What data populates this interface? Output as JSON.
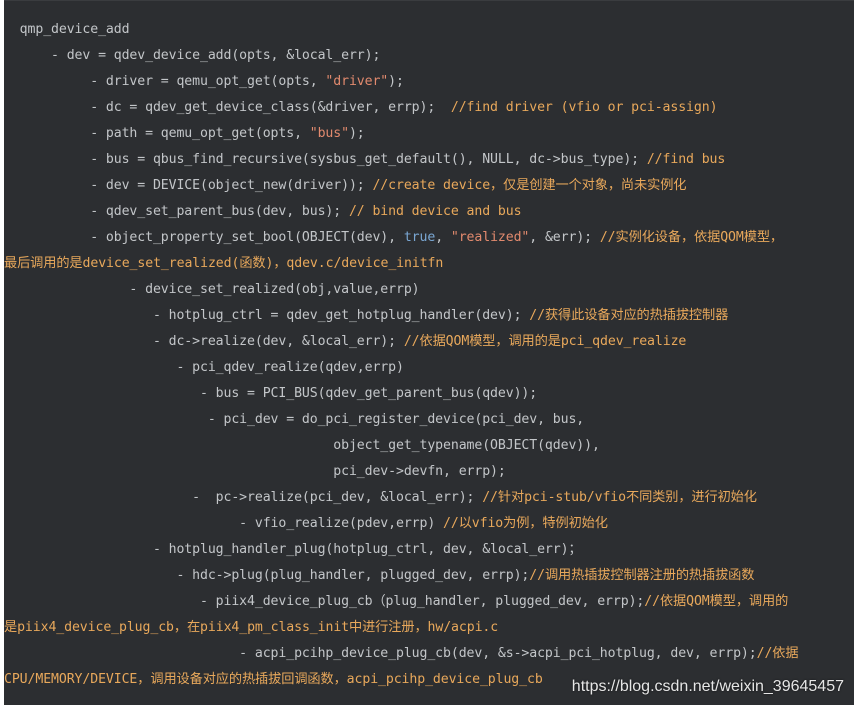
{
  "colors": {
    "background": "#2c2e31",
    "code": "#c3c6c9",
    "string": "#e28a6e",
    "keyword": "#7aa7d3",
    "comment": "#e8a85b"
  },
  "lines": [
    [
      {
        "t": "  qmp_device_add"
      }
    ],
    [
      {
        "t": "      - dev = qdev_device_add(opts, &local_err);"
      }
    ],
    [
      {
        "t": "           - driver = qemu_opt_get(opts, "
      },
      {
        "t": "\"driver\"",
        "c": "str"
      },
      {
        "t": ");"
      }
    ],
    [
      {
        "t": "           - dc = qdev_get_device_class(&driver, errp);  "
      },
      {
        "t": "//find driver (vfio or pci-assign)",
        "c": "cm"
      }
    ],
    [
      {
        "t": "           - path = qemu_opt_get(opts, "
      },
      {
        "t": "\"bus\"",
        "c": "str"
      },
      {
        "t": ");"
      }
    ],
    [
      {
        "t": "           - bus = qbus_find_recursive(sysbus_get_default(), NULL, dc->bus_type); "
      },
      {
        "t": "//find bus",
        "c": "cm"
      }
    ],
    [
      {
        "t": "           - dev = DEVICE(object_new(driver)); "
      },
      {
        "t": "//create device，仅是创建一个对象，尚未实例化",
        "c": "cm"
      }
    ],
    [
      {
        "t": "           - qdev_set_parent_bus(dev, bus); "
      },
      {
        "t": "// bind device and bus",
        "c": "cm"
      }
    ],
    [
      {
        "t": "           - object_property_set_bool(OBJECT(dev), "
      },
      {
        "t": "true",
        "c": "kw"
      },
      {
        "t": ", "
      },
      {
        "t": "\"realized\"",
        "c": "str"
      },
      {
        "t": ", &err); "
      },
      {
        "t": "//实例化设备，依据QOM模型，",
        "c": "cm"
      }
    ],
    [
      {
        "t": "最后调用的是device_set_realized(函数)，qdev.c/device_initfn",
        "c": "cm"
      }
    ],
    [
      {
        "t": "                - device_set_realized(obj,value,errp)"
      }
    ],
    [
      {
        "t": "                   - hotplug_ctrl = qdev_get_hotplug_handler(dev); "
      },
      {
        "t": "//获得此设备对应的热插拔控制器",
        "c": "cm"
      }
    ],
    [
      {
        "t": "                   - dc->realize(dev, &local_err); "
      },
      {
        "t": "//依据QOM模型，调用的是pci_qdev_realize",
        "c": "cm"
      }
    ],
    [
      {
        "t": "                      - pci_qdev_realize(qdev,errp)"
      }
    ],
    [
      {
        "t": "                         - bus = PCI_BUS(qdev_get_parent_bus(qdev));"
      }
    ],
    [
      {
        "t": "                          - pci_dev = do_pci_register_device(pci_dev, bus,"
      }
    ],
    [
      {
        "t": "                                          object_get_typename(OBJECT(qdev)),"
      }
    ],
    [
      {
        "t": "                                          pci_dev->devfn, errp);"
      }
    ],
    [
      {
        "t": "                        -  pc->realize(pci_dev, &local_err); "
      },
      {
        "t": "//针对pci-stub/vfio不同类别，进行初始化",
        "c": "cm"
      }
    ],
    [
      {
        "t": "                              - vfio_realize(pdev,errp) "
      },
      {
        "t": "//以vfio为例，特例初始化",
        "c": "cm"
      }
    ],
    [
      {
        "t": "                   - hotplug_handler_plug(hotplug_ctrl, dev, &local_err)；"
      }
    ],
    [
      {
        "t": "                      - hdc->plug(plug_handler, plugged_dev, errp);"
      },
      {
        "t": "//调用热插拔控制器注册的热插拔函数",
        "c": "cm"
      }
    ],
    [
      {
        "t": "                         - piix4_device_plug_cb（plug_handler, plugged_dev, errp);"
      },
      {
        "t": "//依据QOM模型，调用的",
        "c": "cm"
      }
    ],
    [
      {
        "t": "是piix4_device_plug_cb，在piix4_pm_class_init中进行注册，hw/acpi.c",
        "c": "cm"
      }
    ],
    [
      {
        "t": "                              - acpi_pcihp_device_plug_cb(dev, &s->acpi_pci_hotplug, dev, errp);"
      },
      {
        "t": "//依据",
        "c": "cm"
      }
    ],
    [
      {
        "t": "CPU/MEMORY/DEVICE，调用设备对应的热插拔回调函数，acpi_pcihp_device_plug_cb",
        "c": "cm"
      }
    ]
  ],
  "watermark": "https://blog.csdn.net/weixin_39645457"
}
